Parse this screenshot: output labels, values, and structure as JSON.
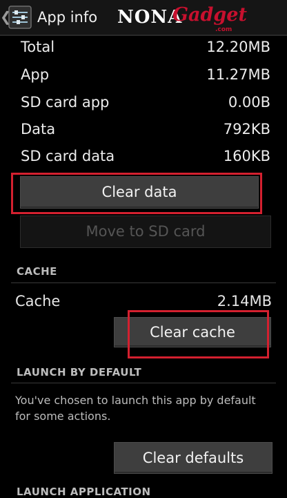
{
  "action_bar": {
    "title": "App info",
    "logo": {
      "nona": "NONA",
      "gadget": "Gadget",
      "com": ".com"
    }
  },
  "storage": {
    "rows": [
      {
        "label": "Total",
        "value": "12.20MB"
      },
      {
        "label": "App",
        "value": "11.27MB"
      },
      {
        "label": "SD card app",
        "value": "0.00B"
      },
      {
        "label": "Data",
        "value": "792KB"
      },
      {
        "label": "SD card data",
        "value": "160KB"
      }
    ],
    "clear_data_label": "Clear data",
    "move_label": "Move to SD card"
  },
  "cache": {
    "header": "CACHE",
    "label": "Cache",
    "value": "2.14MB",
    "clear_label": "Clear cache"
  },
  "launch_default": {
    "header": "LAUNCH BY DEFAULT",
    "description": "You've chosen to launch this app by default for some actions.",
    "clear_label": "Clear defaults"
  },
  "launch_application": {
    "header": "LAUNCH APPLICATION"
  },
  "colors": {
    "highlight": "#d4202f",
    "logo_red": "#c8102e"
  }
}
